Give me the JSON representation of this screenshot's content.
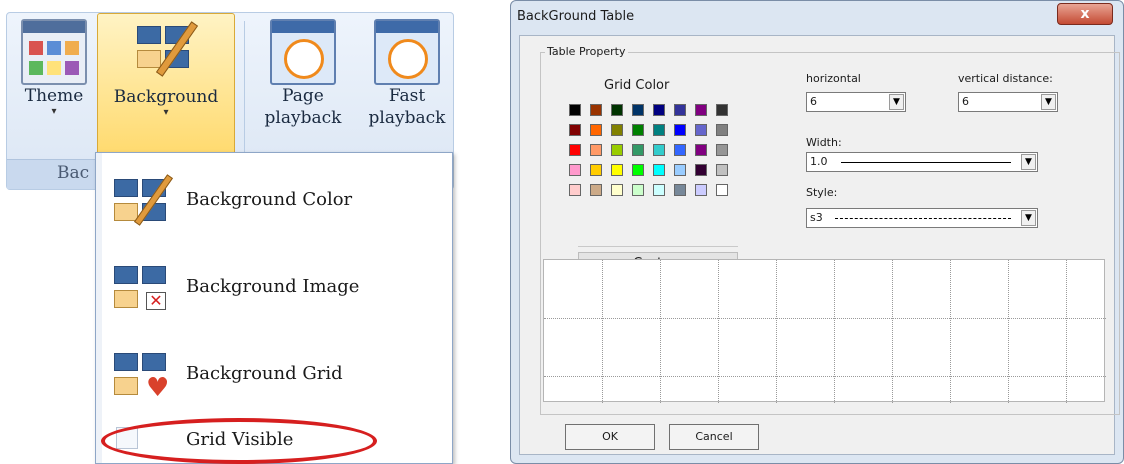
{
  "ribbon": {
    "buttons": [
      {
        "label": "Theme"
      },
      {
        "label": "Background"
      },
      {
        "label_line1": "Page",
        "label_line2": "playback"
      },
      {
        "label_line1": "Fast",
        "label_line2": "playback"
      }
    ],
    "group_label": "Bac"
  },
  "dropdown": {
    "items": [
      {
        "label": "Background Color"
      },
      {
        "label": "Background Image"
      },
      {
        "label": "Background Grid"
      },
      {
        "label": "Grid Visible"
      }
    ],
    "highlight_color": "#d61f1f"
  },
  "dialog": {
    "title": "BackGround Table",
    "close_symbol": "x",
    "table_property_legend": "Table Property",
    "grid_color_label": "Grid Color",
    "swatch_colors": [
      [
        "#000000",
        "#993300",
        "#003300",
        "#003366",
        "#000080",
        "#333399",
        "#800080",
        "#333333"
      ],
      [
        "#800000",
        "#ff6600",
        "#808000",
        "#008000",
        "#008080",
        "#0000ff",
        "#6666cc",
        "#808080"
      ],
      [
        "#ff0000",
        "#ff9966",
        "#99cc00",
        "#339966",
        "#33cccc",
        "#3366ff",
        "#800080",
        "#969696"
      ],
      [
        "#ff99cc",
        "#ffcc00",
        "#ffff00",
        "#00ff00",
        "#00ffff",
        "#99ccff",
        "#330033",
        "#c0c0c0"
      ],
      [
        "#ffcccc",
        "#ccaa88",
        "#ffffcc",
        "#ccffcc",
        "#ccffff",
        "#778899",
        "#ccccff",
        "#ffffff"
      ]
    ],
    "custom_button": "Custom",
    "horizontal": {
      "label": "horizontal",
      "value": "6"
    },
    "vertical": {
      "label": "vertical distance:",
      "value": "6"
    },
    "width": {
      "label": "Width:",
      "value": "1.0"
    },
    "style": {
      "label": "Style:",
      "value": "s3"
    },
    "ok_button": "OK",
    "cancel_button": "Cancel",
    "dropdown_arrow": "▼"
  }
}
